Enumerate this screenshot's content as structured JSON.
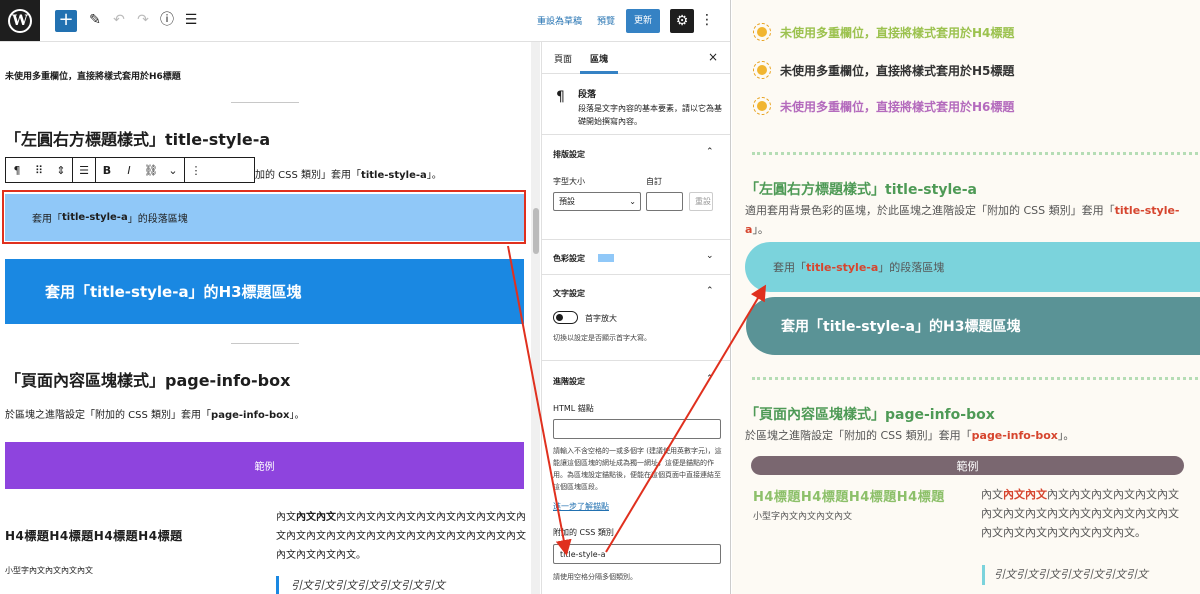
{
  "topbar": {
    "logo": "W",
    "add": "+",
    "edit_icon": "✎",
    "undo": "↶",
    "redo": "↷",
    "info": "ⓘ",
    "list": "☰",
    "save_draft": "重設為草稿",
    "preview": "預覽",
    "update": "更新",
    "settings": "⚙",
    "more": "⋮"
  },
  "canvas": {
    "h6_text": "未使用多重欄位，直接將樣式套用於H6標題",
    "section_a_title": "「左圓右方標題樣式」title-style-a",
    "section_a_desc_pre": "加的 CSS 類別」套用「",
    "section_a_desc_code": "title-style-a",
    "section_a_desc_post": "」。",
    "paragraph_block_pre": "套用「",
    "paragraph_block_code": "title-style-a",
    "paragraph_block_post": "」的段落區塊",
    "h3_block": "套用「title-style-a」的H3標題區塊",
    "section_b_title": "「頁面內容區塊樣式」page-info-box",
    "section_b_desc_pre": "於區塊之進階設定「附加的 CSS 類別」套用「",
    "section_b_desc_code": "page-info-box",
    "section_b_desc_post": "」。",
    "example_btn": "範例",
    "h4_text": "H4標題H4標題H4標題H4標題",
    "small_text": "小型字內文內文內文內文",
    "col_a": "內文",
    "col_b": "內文內文",
    "col_c": "內文內文內文內文內文內文內文內文內文內文內文內文內文內文內文內文內文內文內文內文內文內文內文內文內文內文。",
    "quote": "引文引文引文引文引文引文引文"
  },
  "block_toolbar": {
    "pilcrow": "¶",
    "drag": "⠿",
    "updown": "⇕",
    "align": "☰",
    "bold": "B",
    "italic": "I",
    "link": "⛓",
    "chevron": "⌄",
    "more": "⋮"
  },
  "sidebar": {
    "tab_page": "頁面",
    "tab_block": "區塊",
    "close": "×",
    "block_icon": "¶",
    "block_title": "段落",
    "block_desc": "段落是文字內容的基本要素，請以它為基礎開始撰寫內容。",
    "typography_title": "排版設定",
    "font_size_label": "字型大小",
    "custom_label": "自訂",
    "font_size_value": "預設",
    "reset": "重設",
    "color_title": "色彩設定",
    "text_title": "文字設定",
    "dropcap_label": "首字放大",
    "dropcap_help": "切換以設定是否顯示首字大寫。",
    "advanced_title": "進階設定",
    "anchor_label": "HTML 錨點",
    "anchor_help": "請輸入不含空格的一或多個字 (建議使用英數字元)，這能讓這個區塊的網址成為獨一網址，這便是錨點的作用。為區塊設定錨點後，便能在這個頁面中直接連結至這個區塊區段。",
    "learn_more": "進一步了解錨點",
    "css_label": "附加的 CSS 類別",
    "css_value": "title-style-a",
    "css_help": "請使用空格分隔多個類別。",
    "chev_up": "⌃",
    "chev_down": "⌄"
  },
  "preview": {
    "h4_line": "未使用多重欄位，直接將樣式套用於H4標題",
    "h5_line": "未使用多重欄位，直接將樣式套用於H5標題",
    "h6_line": "未使用多重欄位，直接將樣式套用於H6標題",
    "section_a_title": "「左圓右方標題樣式」title-style-a",
    "section_a_desc_pre": "適用套用背景色彩的區塊，於此區塊之進階設定「附加的 CSS 類別」套用「",
    "section_a_desc_code": "title-style-a",
    "section_a_desc_post": "」。",
    "pill_pre": "套用「",
    "pill_code": "title-style-a",
    "pill_post": "」的段落區塊",
    "h3_block": "套用「title-style-a」的H3標題區塊",
    "section_b_title": "「頁面內容區塊樣式」page-info-box",
    "section_b_desc_pre": "於區塊之進階設定「附加的 CSS 類別」套用「",
    "section_b_desc_code": "page-info-box",
    "section_b_desc_post": "」。",
    "example": "範例",
    "h4_text": "H4標題H4標題H4標題H4標題",
    "small_text": "小型字內文內文內文內文",
    "col_a": "內文",
    "col_b": "內文內文",
    "col_c": "內文內文內文內文內文內文內文內文內文內文內文內文內文內文內文內文內文內文內文內文內文內文。",
    "quote": "引文引文引文引文引文引文引文"
  },
  "colors": {
    "highlight_red": "#e0301e",
    "wp_blue": "#1a88e2",
    "preview_green": "#4e9a56",
    "preview_teal": "#5a9396"
  }
}
